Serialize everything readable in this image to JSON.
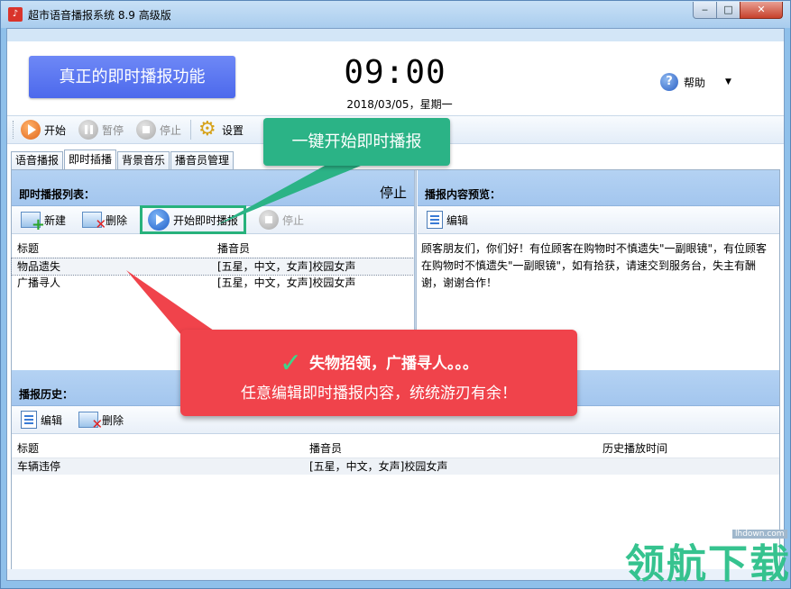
{
  "window": {
    "title": "超市语音播报系统 8.9 高级版"
  },
  "header": {
    "promo": "真正的即时播报功能",
    "clock": "09:00",
    "date": "2018/03/05，星期一",
    "help": "帮助"
  },
  "toolbar": {
    "start": "开始",
    "pause": "暂停",
    "stop": "停止",
    "settings": "设置"
  },
  "tabs": [
    "语音播报",
    "即时插播",
    "背景音乐",
    "播音员管理"
  ],
  "instant_list": {
    "title": "即时播报列表：",
    "status": "停止",
    "new": "新建",
    "delete": "删除",
    "start_instant": "开始即时播报",
    "stop": "停止",
    "columns": [
      "标题",
      "播音员"
    ],
    "rows": [
      {
        "title": "物品遗失",
        "announcer": "[五星，中文，女声]校园女声"
      },
      {
        "title": "广播寻人",
        "announcer": "[五星，中文，女声]校园女声"
      }
    ]
  },
  "preview": {
    "title": "播报内容预览：",
    "edit": "编辑",
    "text": "顾客朋友们，你们好！有位顾客在购物时不慎遗失\"一副眼镜\"，有位顾客在购物时不慎遗失\"一副眼镜\"，如有拾获，请速交到服务台，失主有酬谢，谢谢合作！"
  },
  "history": {
    "title": "播报历史：",
    "edit": "编辑",
    "delete": "删除",
    "columns": [
      "标题",
      "播音员",
      "历史播放时间"
    ],
    "rows": [
      {
        "title": "车辆违停",
        "announcer": "[五星，中文，女声]校园女声",
        "time": ""
      }
    ]
  },
  "callouts": {
    "green": "一键开始即时播报",
    "red_line1": "失物招领，广播寻人。。。",
    "red_line2": "任意编辑即时播报内容，统统游刃有余！"
  },
  "watermark": {
    "text": "领航下载",
    "url": "lhdown.com"
  },
  "colors": {
    "accent_blue": "#4c69ec",
    "callout_green": "#2bb386",
    "callout_red": "#f0434b",
    "panel_header": "#a3c6ee"
  }
}
